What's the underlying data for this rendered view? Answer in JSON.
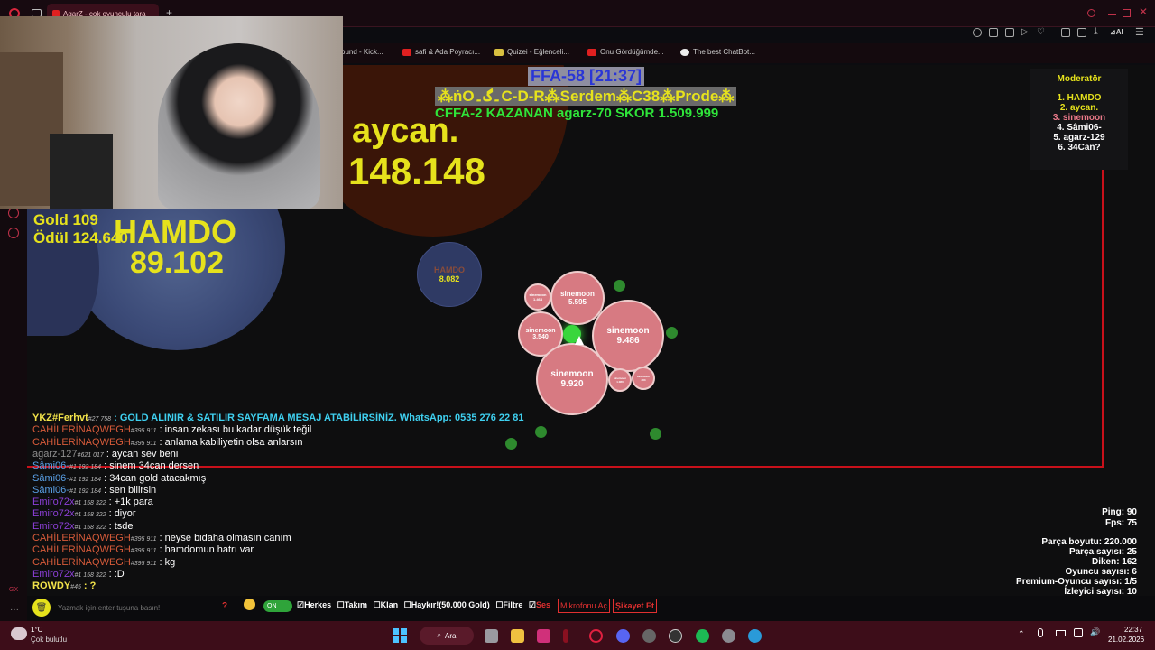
{
  "browser": {
    "tab_title": "AgarZ - çok oyunculu tara",
    "bookmarks": [
      {
        "label": "ound - Kick..."
      },
      {
        "label": "safi & Ada Poyracı..."
      },
      {
        "label": "Quizei - Eğlenceli..."
      },
      {
        "label": "Onu Gördüğümde..."
      },
      {
        "label": "The best ChatBot..."
      }
    ],
    "toolbar_ai_label": "AI"
  },
  "game": {
    "server_title": "FFA-58 [21:37]",
    "clan_banner": "⁂ṅO۔گ۔C-D-R⁂Serdem⁂C38⁂Prode⁂",
    "winner_line": "CFFA-2 KAZANAN agarz-70 SKOR 1.509.999",
    "gold_label": "Gold 109",
    "reward_label": "Ödül 124.640",
    "cells": {
      "aycan_name": "aycan.",
      "aycan_mass": "148.148",
      "hamdo_name": "HAMDO",
      "hamdo_mass": "89.102",
      "hamdo_small_name": "HAMDO",
      "hamdo_small_mass": "8.082",
      "sine_1_name": "sinemoon",
      "sine_1_mass": "5.595",
      "sine_2_name": "sinemoon",
      "sine_2_mass": "9.486",
      "sine_3_name": "sinemoon",
      "sine_3_mass": "3.540",
      "sine_4_name": "sinemoon",
      "sine_4_mass": "9.920",
      "sine_5_name": "sinemoon",
      "sine_5_mass": "1.464",
      "sine_6_name": "sinemoon",
      "sine_6_mass": "1.080",
      "sine_7_name": "sinemoon",
      "sine_7_mass": "383"
    },
    "leaderboard": {
      "title": "Moderatör",
      "entries": [
        "1. HAMDO",
        "2. aycan.",
        "3. sinemoon",
        "4. Sâmi06-",
        "5. agarz-129",
        "6. 34Can?"
      ]
    },
    "stats": {
      "ping": "Ping: 90",
      "fps": "Fps: 75",
      "part_size": "Parça boyutu: 220.000",
      "part_count": "Parça sayısı: 25",
      "thorns": "Diken: 162",
      "players": "Oyuncu sayısı: 6",
      "premium": "Premium-Oyuncu sayısı: 1/5",
      "viewers": "İzleyici sayısı: 10"
    }
  },
  "chat": [
    {
      "name": "YKZ#Ferhvt",
      "id": "#27 758",
      "msg": ": GOLD ALINIR & SATILIR SAYFAMA MESAJ ATABİLİRSİNİZ. WhatsApp: 0535 276 22 81",
      "name_color": "#f2e34a",
      "msg_color": "#3fd0f0"
    },
    {
      "name": "CAHİLERİNAQWEGH",
      "id": "#395 911",
      "msg": ": insan zekası bu kadar düşük teğil",
      "name_color": "#d85b3a",
      "msg_color": "#ffffff"
    },
    {
      "name": "CAHİLERİNAQWEGH",
      "id": "#395 911",
      "msg": ": anlama kabiliyetin olsa anlarsın",
      "name_color": "#d85b3a",
      "msg_color": "#ffffff"
    },
    {
      "name": "agarz-127",
      "id": "#621 017",
      "msg": ": aycan sev beni",
      "name_color": "#8e8e8e",
      "msg_color": "#ffffff"
    },
    {
      "name": "Sâmi06-",
      "id": "#1 192 184",
      "msg": ": sinem 34can dersen",
      "name_color": "#5aa0e6",
      "msg_color": "#ffffff"
    },
    {
      "name": "Sâmi06-",
      "id": "#1 192 184",
      "msg": ": 34can gold atacakmış",
      "name_color": "#5aa0e6",
      "msg_color": "#ffffff"
    },
    {
      "name": "Sâmi06-",
      "id": "#1 192 184",
      "msg": ": sen bilirsin",
      "name_color": "#5aa0e6",
      "msg_color": "#ffffff"
    },
    {
      "name": "Emiro72x",
      "id": "#1 158 322",
      "msg": ": +1k para",
      "name_color": "#8b3fd6",
      "msg_color": "#ffffff"
    },
    {
      "name": "Emiro72x",
      "id": "#1 158 322",
      "msg": ": diyor",
      "name_color": "#8b3fd6",
      "msg_color": "#ffffff"
    },
    {
      "name": "Emiro72x",
      "id": "#1 158 322",
      "msg": ": tsde",
      "name_color": "#8b3fd6",
      "msg_color": "#ffffff"
    },
    {
      "name": "CAHİLERİNAQWEGH",
      "id": "#395 911",
      "msg": ": neyse bidaha olmasın canım",
      "name_color": "#d85b3a",
      "msg_color": "#ffffff"
    },
    {
      "name": "CAHİLERİNAQWEGH",
      "id": "#395 911",
      "msg": ": hamdomun hatrı var",
      "name_color": "#d85b3a",
      "msg_color": "#ffffff"
    },
    {
      "name": "CAHİLERİNAQWEGH",
      "id": "#395 911",
      "msg": ": kg",
      "name_color": "#d85b3a",
      "msg_color": "#ffffff"
    },
    {
      "name": "Emiro72x",
      "id": "#1 158 322",
      "msg": ": :D",
      "name_color": "#8b3fd6",
      "msg_color": "#ffffff"
    },
    {
      "name": "ROWDY",
      "id": "#45",
      "msg": ": ?",
      "name_color": "#f2e34a",
      "msg_color": "#f2e34a"
    }
  ],
  "chat_controls": {
    "input_placeholder": "Yazmak için enter tuşuna basın!",
    "help": "?",
    "toggle_label": "ON",
    "everyone": "Herkes",
    "team": "Takım",
    "clan": "Klan",
    "gift": "Haykır!(50.000 Gold)",
    "filter": "Filtre",
    "sound": "Ses",
    "mic_button": "Mikrofonu Aç",
    "report_button": "Şikayet Et"
  },
  "taskbar": {
    "weather_temp": "1°C",
    "weather_desc": "Çok bulutlu",
    "search_label": "Ara",
    "time": "22:37",
    "date": "21.02.2026"
  },
  "colors": {
    "game_bg": "#0e0e0f",
    "border": "#c8101a",
    "taskbar": "#3d0d19",
    "mass_yellow": "#e6e21c",
    "sinemoon_pink": "#d77a82"
  }
}
